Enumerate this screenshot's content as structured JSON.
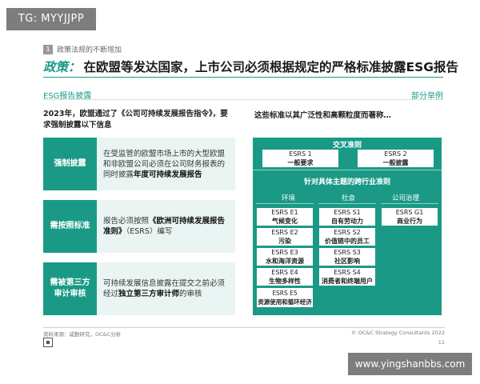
{
  "watermark_top": "TG: MYYJJPP",
  "watermark_bottom": "www.yingshanbbs.com",
  "section": {
    "number": "1",
    "label": "政策法规的不断增加"
  },
  "title": {
    "prefix": "政策：",
    "text": "在欧盟等发达国家，上市公司必须根据规定的严格标准披露ESG报告"
  },
  "headers": {
    "left": "ESG报告披露",
    "right": "部分举例"
  },
  "intro": {
    "left": "2023年，欧盟通过了《公司可持续发展报告指令》，要求强制披露以下信息",
    "right": "这些标准以其广泛性和高颗粒度而著称…"
  },
  "rows": [
    {
      "label": "强制披露",
      "text": "在受监管的欧盟市场上市的大型欧盟和非欧盟公司必须在公司财务报表的同时披露",
      "bold": "年度可持续发展报告",
      "tail": ""
    },
    {
      "label": "需按照标准",
      "text": "报告必须按照",
      "bold": "《欧洲可持续发展报告准则》",
      "tail": "（ESRS）编写"
    },
    {
      "label": "需被第三方审计审核",
      "text": "可持续发展信息披露在提交之前必须经过",
      "bold": "独立第三方审计师",
      "tail": "的审核"
    }
  ],
  "panel": {
    "cross_title": "交叉准则",
    "cross_items": [
      {
        "code": "ESRS 1",
        "name": "一般要求"
      },
      {
        "code": "ESRS 2",
        "name": "一般披露"
      }
    ],
    "topic_title": "针对具体主题的跨行业准则",
    "columns": [
      {
        "head": "环境",
        "items": [
          {
            "code": "ESRS E1",
            "name": "气候变化"
          },
          {
            "code": "ESRS E2",
            "name": "污染"
          },
          {
            "code": "ESRS E3",
            "name": "水和海洋资源"
          },
          {
            "code": "ESRS E4",
            "name": "生物多样性"
          },
          {
            "code": "ESRS E5",
            "name": "资源使用和循环经济"
          }
        ]
      },
      {
        "head": "社会",
        "items": [
          {
            "code": "ESRS S1",
            "name": "自有劳动力"
          },
          {
            "code": "ESRS S2",
            "name": "价值链中的员工"
          },
          {
            "code": "ESRS S3",
            "name": "社区影响"
          },
          {
            "code": "ESRS S4",
            "name": "消费者和终端用户"
          }
        ]
      },
      {
        "head": "公司治理",
        "items": [
          {
            "code": "ESRS G1",
            "name": "商业行为"
          }
        ]
      }
    ]
  },
  "footer": {
    "source": "资料来源：咸勤研究，OC&C分析",
    "copyright": "© OC&C Strategy Consultants 2022",
    "page": "11"
  }
}
